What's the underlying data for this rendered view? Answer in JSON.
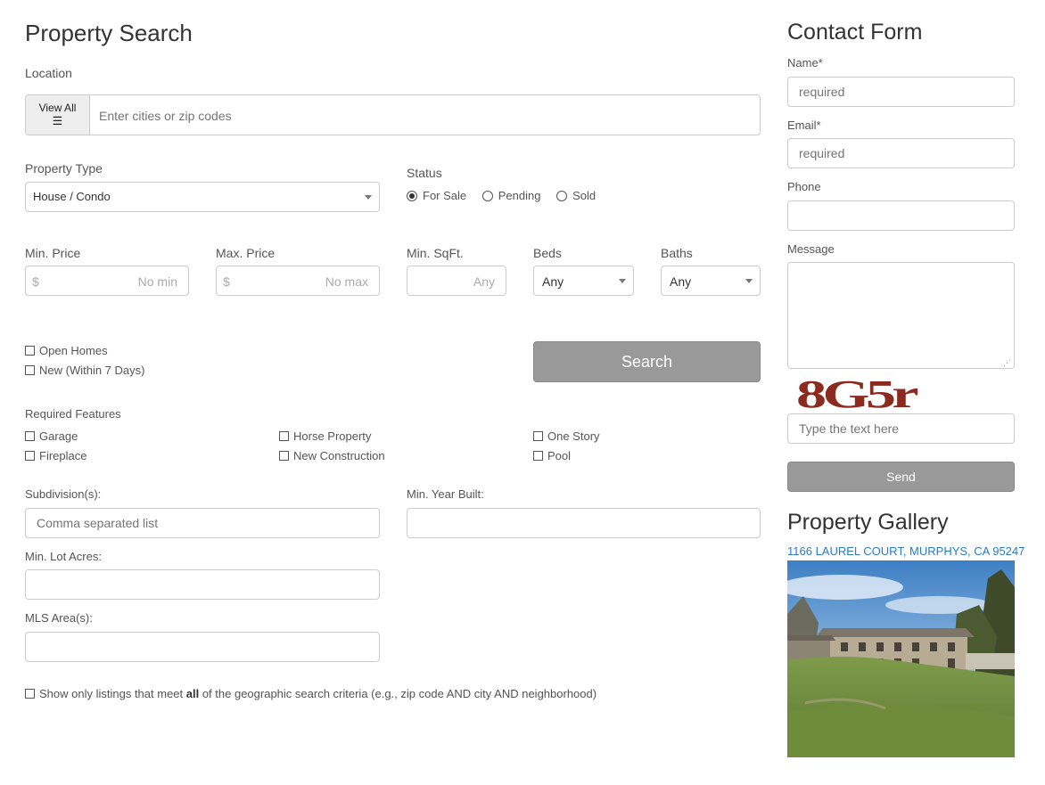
{
  "search": {
    "title": "Property Search",
    "location_label": "Location",
    "view_all_label": "View All",
    "location_placeholder": "Enter cities or zip codes",
    "property_type_label": "Property Type",
    "property_type_value": "House / Condo",
    "status_label": "Status",
    "status_options": [
      "For Sale",
      "Pending",
      "Sold"
    ],
    "status_selected": "For Sale",
    "min_price_label": "Min. Price",
    "min_price_prefix": "$",
    "min_price_placeholder": "No min",
    "max_price_label": "Max. Price",
    "max_price_prefix": "$",
    "max_price_placeholder": "No max",
    "min_sqft_label": "Min. SqFt.",
    "min_sqft_placeholder": "Any",
    "beds_label": "Beds",
    "beds_value": "Any",
    "baths_label": "Baths",
    "baths_value": "Any",
    "open_homes_label": "Open Homes",
    "new_label": "New (Within 7 Days)",
    "search_button": "Search",
    "features_label": "Required Features",
    "features": [
      "Garage",
      "Horse Property",
      "One Story",
      "Fireplace",
      "New Construction",
      "Pool"
    ],
    "subdivision_label": "Subdivision(s):",
    "subdivision_placeholder": "Comma separated list",
    "min_year_label": "Min. Year Built:",
    "min_lot_label": "Min. Lot Acres:",
    "mls_area_label": "MLS Area(s):",
    "geo_all_prefix": "Show only listings that meet ",
    "geo_all_bold": "all",
    "geo_all_suffix": " of the geographic search criteria (e.g., zip code AND city AND neighborhood)"
  },
  "contact": {
    "title": "Contact Form",
    "name_label": "Name*",
    "name_placeholder": "required",
    "email_label": "Email*",
    "email_placeholder": "required",
    "phone_label": "Phone",
    "message_label": "Message",
    "captcha_text": "8G5r",
    "captcha_placeholder": "Type the text here",
    "send_button": "Send"
  },
  "gallery": {
    "title": "Property Gallery",
    "address": "1166 LAUREL COURT, MURPHYS, CA 95247"
  },
  "colors": {
    "button_gray": "#999999",
    "link_blue": "#2a7cc7",
    "captcha_red": "#8b2a1f"
  }
}
